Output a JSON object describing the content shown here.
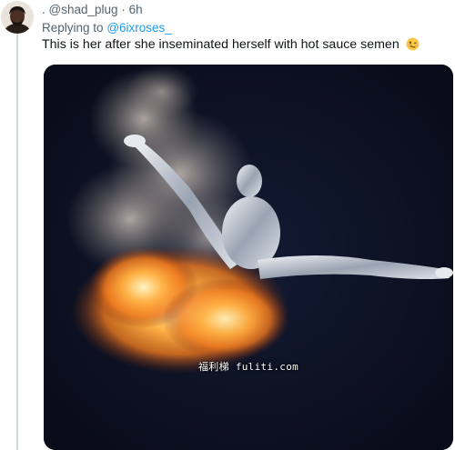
{
  "tweet": {
    "dot_prefix": ".",
    "handle": "@shad_plug",
    "separator": "·",
    "time": "6h",
    "replying_prefix": "Replying to",
    "replying_to": "@6ixroses_",
    "text": "This is her after she inseminated herself with hot sauce semen",
    "emoji": "woozy-face",
    "link_color": "#1d9bf0",
    "muted_color": "#536471"
  },
  "media": {
    "watermark": "福利梯 fuliti.com"
  }
}
